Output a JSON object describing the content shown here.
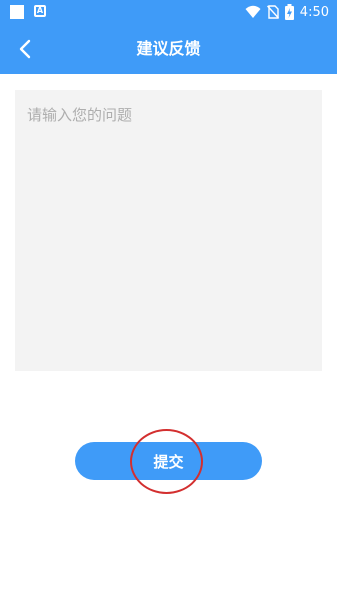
{
  "status_bar": {
    "time": "4:50",
    "icons": [
      "notification-square-icon",
      "app-notification-icon",
      "wifi-icon",
      "no-sim-icon",
      "battery-charging-icon"
    ]
  },
  "header": {
    "title": "建议反馈",
    "back_icon": "chevron-left-icon"
  },
  "form": {
    "placeholder": "请输入您的问题",
    "value": "",
    "submit_label": "提交"
  },
  "colors": {
    "primary": "#3f9bf8",
    "input_background": "#f3f3f3",
    "annotation": "#d32f2f"
  }
}
